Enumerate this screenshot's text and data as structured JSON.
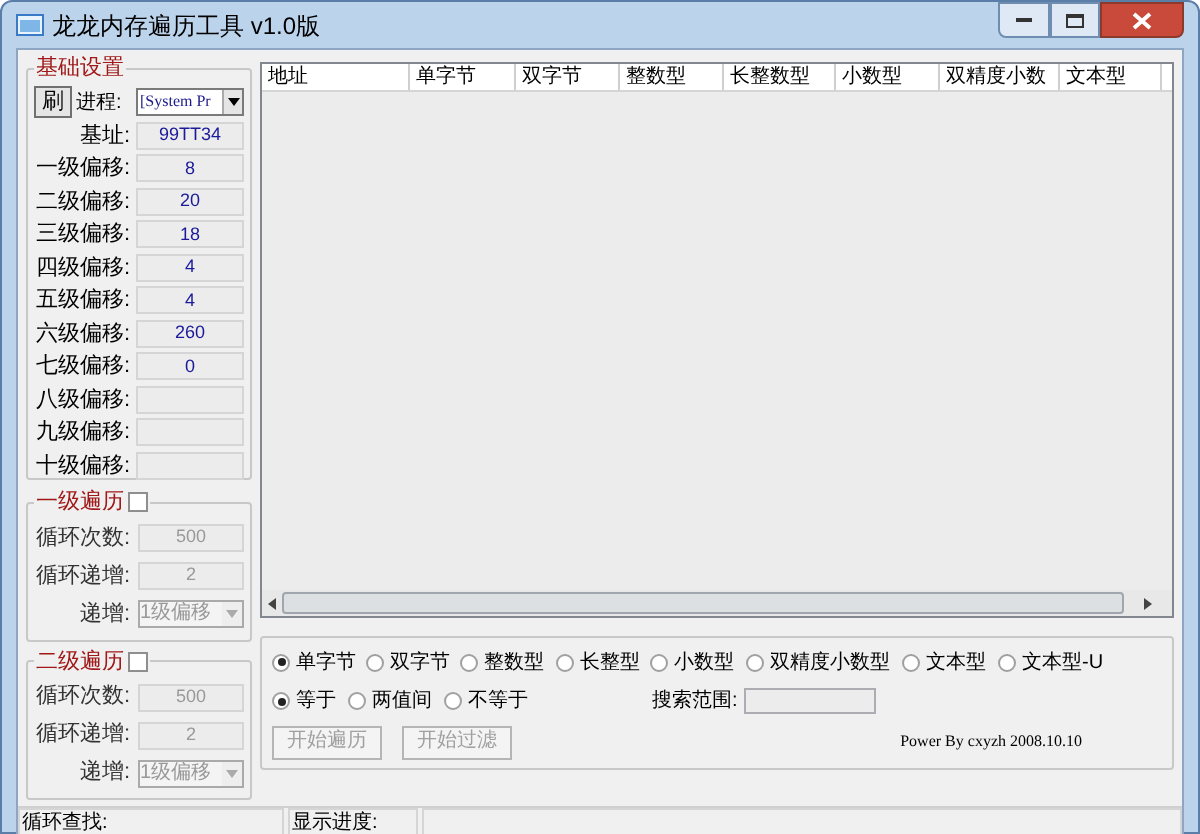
{
  "window": {
    "title": "龙龙内存遍历工具 v1.0版"
  },
  "base_settings": {
    "title": "基础设置",
    "refresh_button": "刷",
    "process_label": "进程:",
    "process_value": "[System Pr",
    "base_label": "基址:",
    "base_value": "99TT34",
    "offsets": [
      {
        "label": "一级偏移:",
        "value": "8"
      },
      {
        "label": "二级偏移:",
        "value": "20"
      },
      {
        "label": "三级偏移:",
        "value": "18"
      },
      {
        "label": "四级偏移:",
        "value": "4"
      },
      {
        "label": "五级偏移:",
        "value": "4"
      },
      {
        "label": "六级偏移:",
        "value": "260"
      },
      {
        "label": "七级偏移:",
        "value": "0"
      },
      {
        "label": "八级偏移:"
      },
      {
        "label": "九级偏移:"
      },
      {
        "label": "十级偏移:"
      }
    ]
  },
  "loop_groups": [
    {
      "title": "一级遍历",
      "checked": false,
      "count_label": "循环次数:",
      "count_value": "500",
      "step_label": "循环递增:",
      "step_value": "2",
      "increment_label": "递增:",
      "increment_value": "1级偏移"
    },
    {
      "title": "二级遍历",
      "checked": false,
      "count_label": "循环次数:",
      "count_value": "500",
      "step_label": "循环递增:",
      "step_value": "2",
      "increment_label": "递增:",
      "increment_value": "1级偏移"
    }
  ],
  "table": {
    "columns": [
      "地址",
      "单字节",
      "双字节",
      "整数型",
      "长整数型",
      "小数型",
      "双精度小数",
      "文本型"
    ]
  },
  "options": {
    "types": [
      {
        "label": "单字节",
        "selected": true
      },
      {
        "label": "双字节",
        "selected": false
      },
      {
        "label": "整数型",
        "selected": false
      },
      {
        "label": "长整型",
        "selected": false
      },
      {
        "label": "小数型",
        "selected": false
      },
      {
        "label": "双精度小数型",
        "selected": false
      },
      {
        "label": "文本型",
        "selected": false
      },
      {
        "label": "文本型-U",
        "selected": false
      }
    ],
    "compare": [
      {
        "label": "等于",
        "selected": true
      },
      {
        "label": "两值间",
        "selected": false
      },
      {
        "label": "不等于",
        "selected": false
      }
    ],
    "range_label": "搜索范围:",
    "buttons": [
      {
        "label": "开始遍历",
        "disabled": true
      },
      {
        "label": "开始过滤",
        "disabled": true
      }
    ],
    "credit": "Power By cxyzh 2008.10.10"
  },
  "status_bar": [
    "循环查找:",
    "显示进度:"
  ]
}
